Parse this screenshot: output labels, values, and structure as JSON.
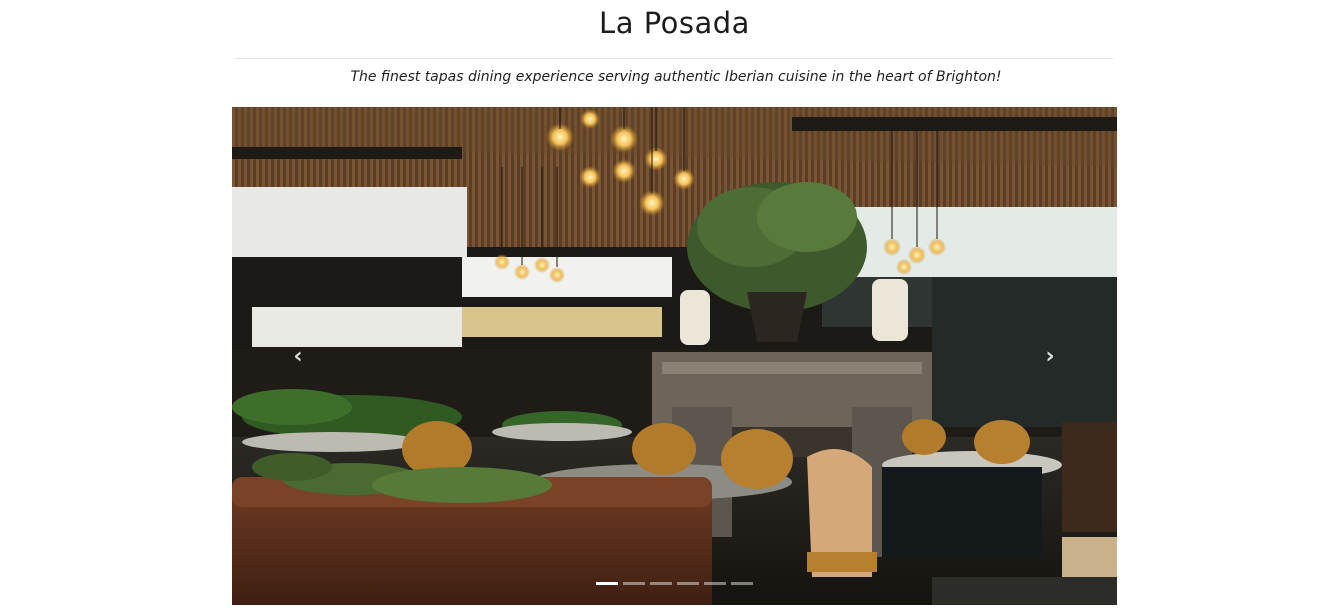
{
  "header": {
    "title": "La Posada",
    "tagline": "The finest tapas dining experience serving authentic Iberian cuisine in the heart of Brighton!"
  },
  "carousel": {
    "prev_icon": "‹",
    "next_icon": "›",
    "slide_count": 6,
    "active_index": 0,
    "image_description": "restaurant-interior-photo"
  },
  "colors": {
    "accent": "#ffffff",
    "text": "#1d1d1d"
  }
}
